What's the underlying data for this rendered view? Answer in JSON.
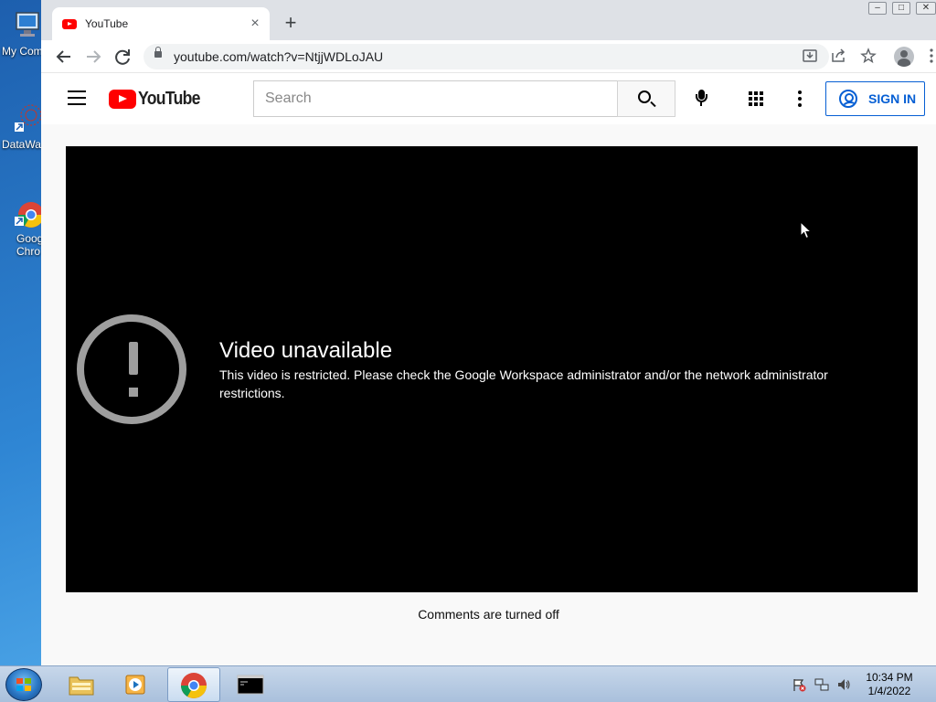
{
  "desktop": {
    "icons": [
      {
        "label": "My Com",
        "icon": "computer-icon"
      },
      {
        "label": "DataWa",
        "icon": "datawarehouse-icon"
      },
      {
        "label": "Goog\nChro",
        "icon": "chrome-icon"
      }
    ]
  },
  "browser": {
    "tab": {
      "title": "YouTube",
      "close": "×",
      "favicon": "youtube-favicon-icon"
    },
    "new_tab": "+",
    "window_controls": [
      "–",
      "□",
      "✕"
    ],
    "address": {
      "url": "youtube.com/watch?v=NtjjWDLoJAU"
    }
  },
  "youtube": {
    "logo_text": "YouTube",
    "search": {
      "placeholder": "Search"
    },
    "sign_in_label": "SIGN IN",
    "error": {
      "title": "Video unavailable",
      "message": "This video is restricted. Please check the Google Workspace administrator and/or the network administrator restrictions."
    },
    "comments_status": "Comments are turned off"
  },
  "taskbar": {
    "clock": {
      "time": "10:34 PM",
      "date": "1/4/2022"
    }
  },
  "colors": {
    "youtube_red": "#ff0000",
    "signin_blue": "#065fd4",
    "player_bg": "#000000",
    "error_icon_gray": "#9e9e9e"
  }
}
